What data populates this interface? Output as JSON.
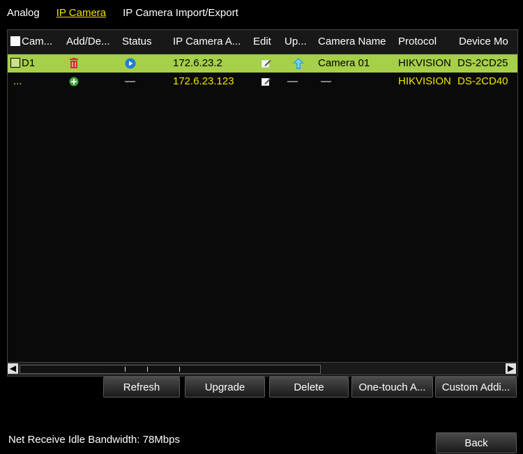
{
  "tabs": {
    "analog": "Analog",
    "ip_camera": "IP Camera",
    "import_export": "IP Camera Import/Export"
  },
  "table": {
    "headers": {
      "camera": "Cam...",
      "add_delete": "Add/De...",
      "status": "Status",
      "ip_address": "IP Camera A...",
      "edit": "Edit",
      "upgrade": "Up...",
      "camera_name": "Camera Name",
      "protocol": "Protocol",
      "device_model": "Device Mo"
    },
    "rows": [
      {
        "camera": "D1",
        "ip_address": "172.6.23.2",
        "camera_name": "Camera 01",
        "protocol": "HIKVISION",
        "device_model": "DS-2CD25"
      },
      {
        "camera": "...",
        "status": "—",
        "ip_address": "172.6.23.123",
        "upgrade": "—",
        "camera_name": "—",
        "protocol": "HIKVISION",
        "device_model": "DS-2CD40"
      }
    ]
  },
  "icons": {
    "delete": "trash-icon",
    "add": "plus-circle-icon",
    "play": "play-circle-icon",
    "edit": "edit-icon",
    "upgrade": "arrow-up-icon"
  },
  "buttons": {
    "refresh": "Refresh",
    "upgrade": "Upgrade",
    "delete": "Delete",
    "one_touch": "One-touch A...",
    "custom_add": "Custom Addi...",
    "back": "Back"
  },
  "status": {
    "bandwidth": "Net Receive Idle Bandwidth: 78Mbps"
  },
  "colors": {
    "accent": "#f2e400",
    "selected_row": "#a6cf4a",
    "background": "#000000",
    "delete_icon": "#d32f2f",
    "add_icon": "#3da83d",
    "play_icon": "#1f7fd1",
    "upgrade_icon": "#2aa6e0"
  }
}
